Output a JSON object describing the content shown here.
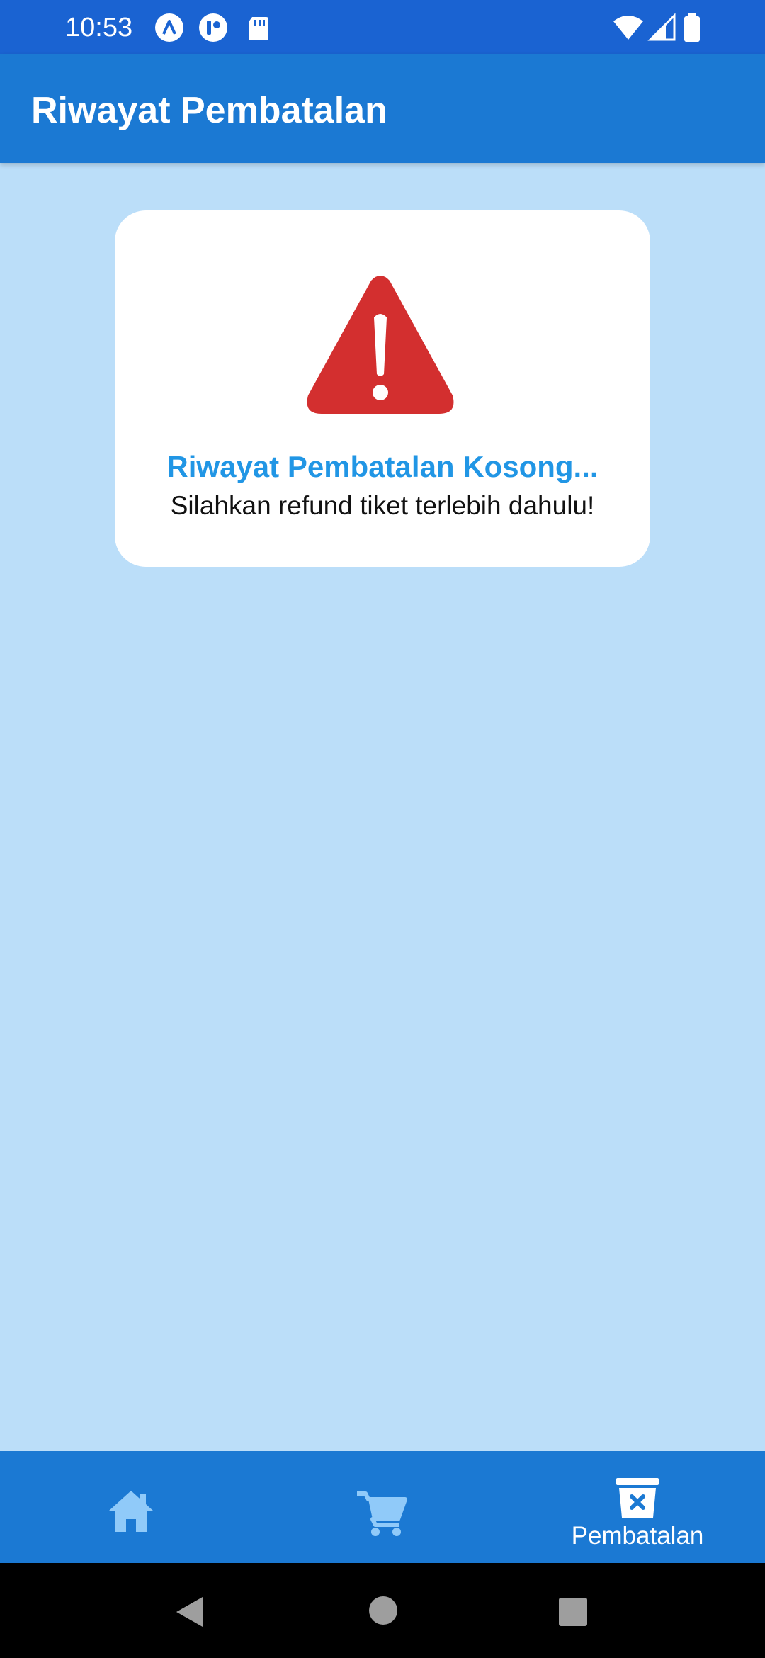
{
  "status_bar": {
    "time": "10:53",
    "icons": [
      "notification-a-icon",
      "notification-p-icon",
      "sd-card-icon",
      "wifi-icon",
      "signal-icon",
      "battery-icon"
    ]
  },
  "app_bar": {
    "title": "Riwayat Pembatalan"
  },
  "empty_state": {
    "icon": "warning-icon",
    "title": "Riwayat Pembatalan Kosong...",
    "subtitle": "Silahkan refund tiket terlebih dahulu!"
  },
  "bottom_nav": {
    "items": [
      {
        "icon": "home-icon",
        "label": ""
      },
      {
        "icon": "cart-icon",
        "label": ""
      },
      {
        "icon": "cancel-bin-icon",
        "label": "Pembatalan",
        "active": true
      }
    ]
  },
  "system_nav": [
    "back-icon",
    "home-circle-icon",
    "recents-icon"
  ],
  "colors": {
    "status_bar": "#1A63D2",
    "app_bar": "#1B79D3",
    "background": "#BBDEF9",
    "accent_text": "#2196E5",
    "warning": "#D32F2F",
    "inactive_nav_icon": "#90CAF9"
  }
}
